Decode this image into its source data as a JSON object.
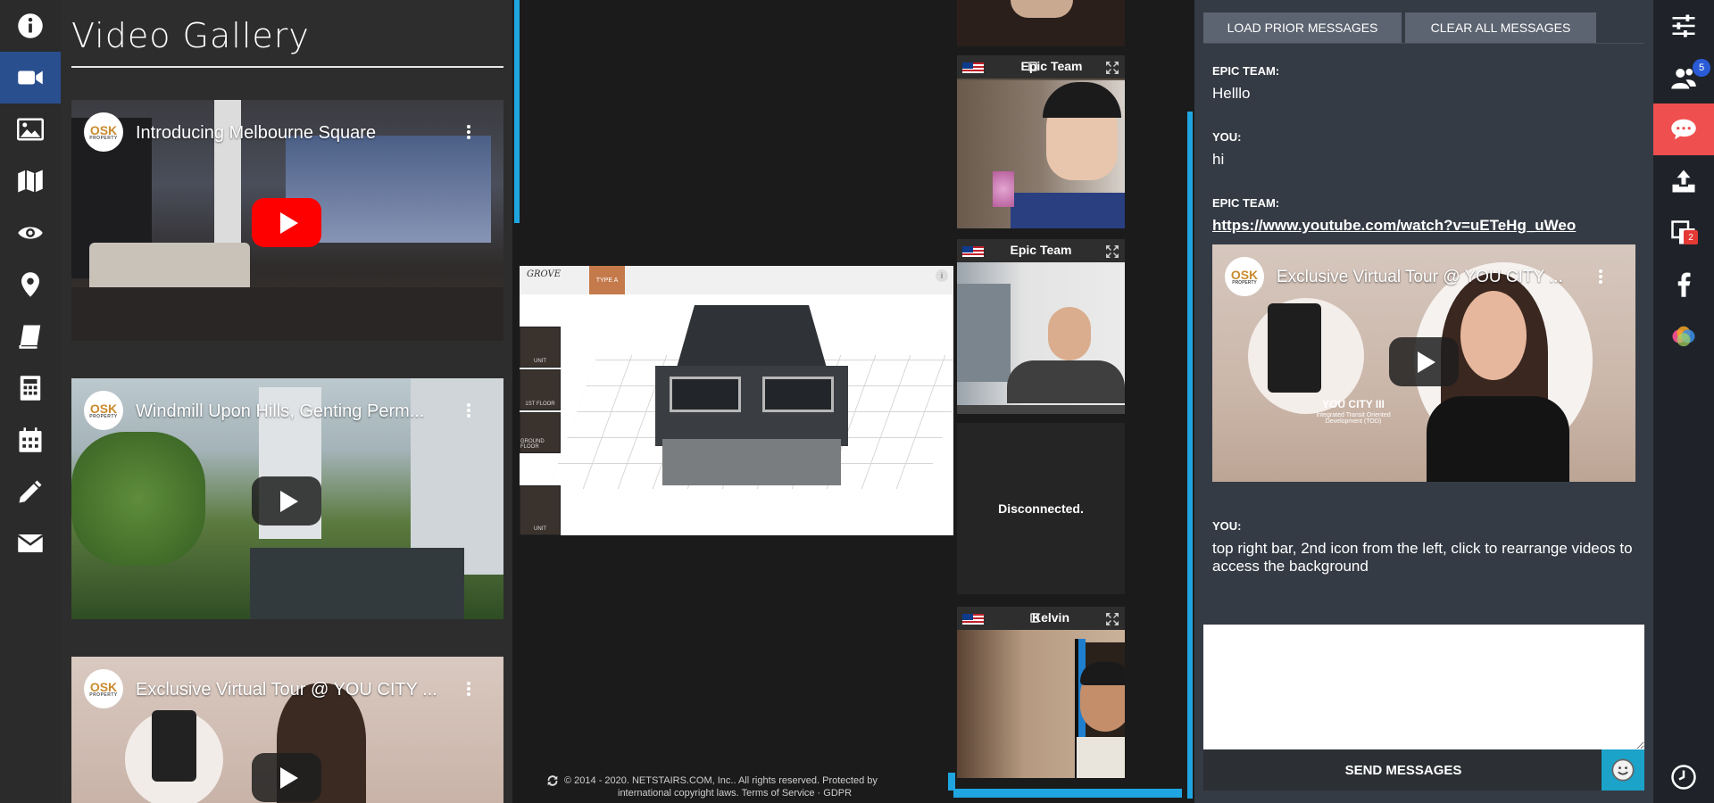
{
  "gallery": {
    "title": "Video Gallery",
    "videos": [
      {
        "title": "Introducing Melbourne Square",
        "logo": "OSK",
        "logo_sub": "PROPERTY"
      },
      {
        "title": "Windmill Upon Hills, Genting Perm...",
        "logo": "OSK",
        "logo_sub": "PROPERTY"
      },
      {
        "title": "Exclusive Virtual Tour @ YOU CITY ...",
        "logo": "OSK",
        "logo_sub": "PROPERTY"
      }
    ]
  },
  "left_nav": {
    "icons": [
      "info-icon",
      "video-icon",
      "image-icon",
      "map-icon",
      "eye-icon",
      "location-pin-icon",
      "book-icon",
      "calculator-icon",
      "calendar-icon",
      "pencil-icon",
      "envelope-icon"
    ],
    "active": "video-icon"
  },
  "stage": {
    "brand": "GROVE",
    "tag": "TYPE A",
    "side_buttons": [
      "UNIT",
      "1ST FLOOR",
      "GROUND FLOOR",
      "UNIT"
    ]
  },
  "footer": {
    "line1": "© 2014 - 2020. NETSTAIRS.COM, Inc.. All rights reserved. Protected by",
    "line2": "international copyright laws. Terms of Service · GDPR"
  },
  "tiles": [
    {
      "name": "",
      "flag": true
    },
    {
      "name": "Epic Team",
      "flag": true,
      "locked": true
    },
    {
      "name": "Epic Team",
      "flag": true
    },
    {
      "name": "",
      "status": "Disconnected."
    },
    {
      "name": "Kelvin",
      "flag": true,
      "locked": true
    }
  ],
  "chat": {
    "load_prior": "LOAD PRIOR MESSAGES",
    "clear_all": "CLEAR ALL MESSAGES",
    "messages": [
      {
        "sender": "EPIC TEAM:",
        "text": "Helllo"
      },
      {
        "sender": "YOU:",
        "text": "hi"
      },
      {
        "sender": "EPIC TEAM:",
        "text": "https://www.youtube.com/watch?v=uETeHg_uWeo"
      },
      {
        "sender": "YOU:",
        "text": "top right bar, 2nd icon from the left, click to rearrange videos to access the background"
      }
    ],
    "embed_title": "Exclusive Virtual Tour @ YOU CITY ...",
    "embed_logo": "OSK",
    "embed_logo_sub": "PROPERTY",
    "embed_caption": "YOU CITY III",
    "embed_caption_sub": "Integrated Transit Oriented Development (TOD)",
    "input_value": "",
    "send_label": "SEND MESSAGES"
  },
  "right_nav": {
    "icons": [
      "sliders-icon",
      "users-icon",
      "chat-icon",
      "upload-icon",
      "copy-icon",
      "facebook-icon",
      "color-circles-icon",
      "clock-icon"
    ],
    "active": "chat-icon",
    "users_badge": "5",
    "copy_badge": "2"
  },
  "colors": {
    "accent_blue": "#1fa5e0",
    "chat_active": "#ef4f4f",
    "active_left": "#2a4f8f"
  }
}
